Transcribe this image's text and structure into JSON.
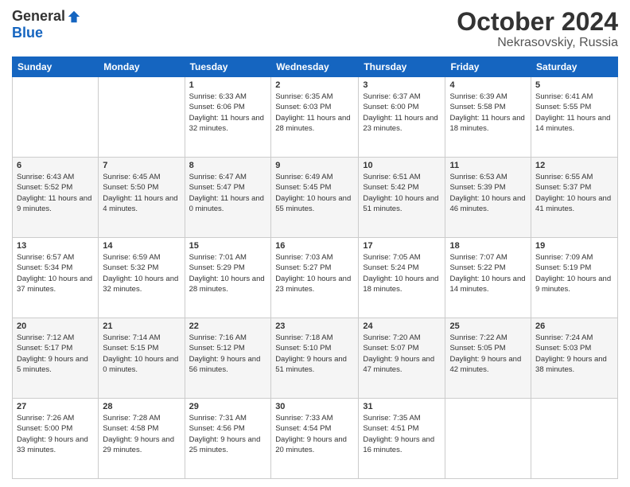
{
  "logo": {
    "general": "General",
    "blue": "Blue"
  },
  "header": {
    "month": "October 2024",
    "location": "Nekrasovskiy, Russia"
  },
  "weekdays": [
    "Sunday",
    "Monday",
    "Tuesday",
    "Wednesday",
    "Thursday",
    "Friday",
    "Saturday"
  ],
  "weeks": [
    [
      null,
      null,
      {
        "day": 1,
        "sunrise": "6:33 AM",
        "sunset": "6:06 PM",
        "daylight": "11 hours and 32 minutes."
      },
      {
        "day": 2,
        "sunrise": "6:35 AM",
        "sunset": "6:03 PM",
        "daylight": "11 hours and 28 minutes."
      },
      {
        "day": 3,
        "sunrise": "6:37 AM",
        "sunset": "6:00 PM",
        "daylight": "11 hours and 23 minutes."
      },
      {
        "day": 4,
        "sunrise": "6:39 AM",
        "sunset": "5:58 PM",
        "daylight": "11 hours and 18 minutes."
      },
      {
        "day": 5,
        "sunrise": "6:41 AM",
        "sunset": "5:55 PM",
        "daylight": "11 hours and 14 minutes."
      }
    ],
    [
      {
        "day": 6,
        "sunrise": "6:43 AM",
        "sunset": "5:52 PM",
        "daylight": "11 hours and 9 minutes."
      },
      {
        "day": 7,
        "sunrise": "6:45 AM",
        "sunset": "5:50 PM",
        "daylight": "11 hours and 4 minutes."
      },
      {
        "day": 8,
        "sunrise": "6:47 AM",
        "sunset": "5:47 PM",
        "daylight": "11 hours and 0 minutes."
      },
      {
        "day": 9,
        "sunrise": "6:49 AM",
        "sunset": "5:45 PM",
        "daylight": "10 hours and 55 minutes."
      },
      {
        "day": 10,
        "sunrise": "6:51 AM",
        "sunset": "5:42 PM",
        "daylight": "10 hours and 51 minutes."
      },
      {
        "day": 11,
        "sunrise": "6:53 AM",
        "sunset": "5:39 PM",
        "daylight": "10 hours and 46 minutes."
      },
      {
        "day": 12,
        "sunrise": "6:55 AM",
        "sunset": "5:37 PM",
        "daylight": "10 hours and 41 minutes."
      }
    ],
    [
      {
        "day": 13,
        "sunrise": "6:57 AM",
        "sunset": "5:34 PM",
        "daylight": "10 hours and 37 minutes."
      },
      {
        "day": 14,
        "sunrise": "6:59 AM",
        "sunset": "5:32 PM",
        "daylight": "10 hours and 32 minutes."
      },
      {
        "day": 15,
        "sunrise": "7:01 AM",
        "sunset": "5:29 PM",
        "daylight": "10 hours and 28 minutes."
      },
      {
        "day": 16,
        "sunrise": "7:03 AM",
        "sunset": "5:27 PM",
        "daylight": "10 hours and 23 minutes."
      },
      {
        "day": 17,
        "sunrise": "7:05 AM",
        "sunset": "5:24 PM",
        "daylight": "10 hours and 18 minutes."
      },
      {
        "day": 18,
        "sunrise": "7:07 AM",
        "sunset": "5:22 PM",
        "daylight": "10 hours and 14 minutes."
      },
      {
        "day": 19,
        "sunrise": "7:09 AM",
        "sunset": "5:19 PM",
        "daylight": "10 hours and 9 minutes."
      }
    ],
    [
      {
        "day": 20,
        "sunrise": "7:12 AM",
        "sunset": "5:17 PM",
        "daylight": "9 hours and 5 minutes."
      },
      {
        "day": 21,
        "sunrise": "7:14 AM",
        "sunset": "5:15 PM",
        "daylight": "10 hours and 0 minutes."
      },
      {
        "day": 22,
        "sunrise": "7:16 AM",
        "sunset": "5:12 PM",
        "daylight": "9 hours and 56 minutes."
      },
      {
        "day": 23,
        "sunrise": "7:18 AM",
        "sunset": "5:10 PM",
        "daylight": "9 hours and 51 minutes."
      },
      {
        "day": 24,
        "sunrise": "7:20 AM",
        "sunset": "5:07 PM",
        "daylight": "9 hours and 47 minutes."
      },
      {
        "day": 25,
        "sunrise": "7:22 AM",
        "sunset": "5:05 PM",
        "daylight": "9 hours and 42 minutes."
      },
      {
        "day": 26,
        "sunrise": "7:24 AM",
        "sunset": "5:03 PM",
        "daylight": "9 hours and 38 minutes."
      }
    ],
    [
      {
        "day": 27,
        "sunrise": "7:26 AM",
        "sunset": "5:00 PM",
        "daylight": "9 hours and 33 minutes."
      },
      {
        "day": 28,
        "sunrise": "7:28 AM",
        "sunset": "4:58 PM",
        "daylight": "9 hours and 29 minutes."
      },
      {
        "day": 29,
        "sunrise": "7:31 AM",
        "sunset": "4:56 PM",
        "daylight": "9 hours and 25 minutes."
      },
      {
        "day": 30,
        "sunrise": "7:33 AM",
        "sunset": "4:54 PM",
        "daylight": "9 hours and 20 minutes."
      },
      {
        "day": 31,
        "sunrise": "7:35 AM",
        "sunset": "4:51 PM",
        "daylight": "9 hours and 16 minutes."
      },
      null,
      null
    ]
  ],
  "labels": {
    "sunrise": "Sunrise:",
    "sunset": "Sunset:",
    "daylight": "Daylight:"
  }
}
